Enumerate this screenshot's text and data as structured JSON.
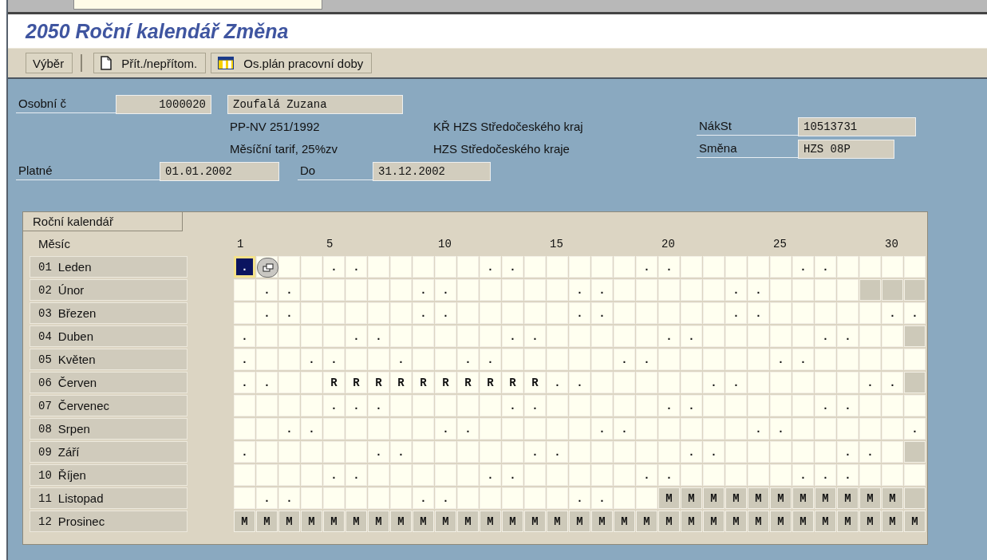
{
  "window": {
    "title": "2050 Roční kalendář Změna"
  },
  "toolbar": [
    {
      "label": "Výběr",
      "kind": "plain",
      "separator_after": true
    },
    {
      "label": "Přít./nepřítom.",
      "kind": "document",
      "separator_after": false
    },
    {
      "label": "Os.plán pracovní doby",
      "kind": "planner",
      "separator_after": false
    }
  ],
  "header": {
    "personnel_label": "Osobní č",
    "personnel_number": "1000020",
    "employee_name": "Zoufalá Zuzana",
    "line_2": {
      "left": "PP-NV 251/1992",
      "middle": "KŘ HZS Středočeského kraj",
      "label": "NákSt",
      "value": "10513731"
    },
    "line_3": {
      "left": "Měsíční tarif, 25%zv",
      "middle": "HZS Středočeského kraje",
      "label": "Směna",
      "value": "HZS 08P"
    },
    "valid_label": "Platné",
    "valid_from": "01.01.2002",
    "to_label": "Do",
    "valid_to": "31.12.2002"
  },
  "calendar": {
    "title": "Roční kalendář",
    "month_heading": "Měsíc",
    "day_header": [
      {
        "label": "1"
      },
      {
        "label": "5"
      },
      {
        "label": "10"
      },
      {
        "label": "15"
      },
      {
        "label": "20"
      },
      {
        "label": "25"
      },
      {
        "label": "30"
      }
    ],
    "months": [
      {
        "number": "01",
        "name": "Leden",
        "days": [
          {
            "text": ".",
            "shaded": false,
            "selected": true
          },
          {
            "shaded": false,
            "selected": false
          },
          {
            "shaded": false,
            "selected": false
          },
          {
            "shaded": false,
            "selected": false
          },
          {
            "text": ".",
            "shaded": false,
            "selected": false
          },
          {
            "text": ".",
            "shaded": false,
            "selected": false
          },
          {
            "shaded": false,
            "selected": false
          },
          {
            "shaded": false,
            "selected": false
          },
          {
            "shaded": false,
            "selected": false
          },
          {
            "shaded": false,
            "selected": false
          },
          {
            "shaded": false,
            "selected": false
          },
          {
            "text": ".",
            "shaded": false,
            "selected": false
          },
          {
            "text": ".",
            "shaded": false,
            "selected": false
          },
          {
            "shaded": false,
            "selected": false
          },
          {
            "shaded": false,
            "selected": false
          },
          {
            "shaded": false,
            "selected": false
          },
          {
            "shaded": false,
            "selected": false
          },
          {
            "shaded": false,
            "selected": false
          },
          {
            "text": ".",
            "shaded": false,
            "selected": false
          },
          {
            "text": ".",
            "shaded": false,
            "selected": false
          },
          {
            "shaded": false,
            "selected": false
          },
          {
            "shaded": false,
            "selected": false
          },
          {
            "shaded": false,
            "selected": false
          },
          {
            "shaded": false,
            "selected": false
          },
          {
            "shaded": false,
            "selected": false
          },
          {
            "text": ".",
            "shaded": false,
            "selected": false
          },
          {
            "text": ".",
            "shaded": false,
            "selected": false
          },
          {
            "shaded": false,
            "selected": false
          },
          {
            "shaded": false,
            "selected": false
          },
          {
            "shaded": false,
            "selected": false
          },
          {
            "shaded": false,
            "selected": false
          }
        ]
      },
      {
        "number": "02",
        "name": "Únor",
        "days": [
          {
            "shaded": false,
            "selected": false
          },
          {
            "text": ".",
            "shaded": false,
            "selected": false
          },
          {
            "text": ".",
            "shaded": false,
            "selected": false
          },
          {
            "shaded": false,
            "selected": false
          },
          {
            "shaded": false,
            "selected": false
          },
          {
            "shaded": false,
            "selected": false
          },
          {
            "shaded": false,
            "selected": false
          },
          {
            "shaded": false,
            "selected": false
          },
          {
            "text": ".",
            "shaded": false,
            "selected": false
          },
          {
            "text": ".",
            "shaded": false,
            "selected": false
          },
          {
            "shaded": false,
            "selected": false
          },
          {
            "shaded": false,
            "selected": false
          },
          {
            "shaded": false,
            "selected": false
          },
          {
            "shaded": false,
            "selected": false
          },
          {
            "shaded": false,
            "selected": false
          },
          {
            "text": ".",
            "shaded": false,
            "selected": false
          },
          {
            "text": ".",
            "shaded": false,
            "selected": false
          },
          {
            "shaded": false,
            "selected": false
          },
          {
            "shaded": false,
            "selected": false
          },
          {
            "shaded": false,
            "selected": false
          },
          {
            "shaded": false,
            "selected": false
          },
          {
            "shaded": false,
            "selected": false
          },
          {
            "text": ".",
            "shaded": false,
            "selected": false
          },
          {
            "text": ".",
            "shaded": false,
            "selected": false
          },
          {
            "shaded": false,
            "selected": false
          },
          {
            "shaded": false,
            "selected": false
          },
          {
            "shaded": false,
            "selected": false
          },
          {
            "shaded": false,
            "selected": false
          },
          {
            "shaded": true,
            "selected": false
          },
          {
            "shaded": true,
            "selected": false
          },
          {
            "shaded": true,
            "selected": false
          }
        ]
      },
      {
        "number": "03",
        "name": "Březen",
        "days": [
          {
            "shaded": false,
            "selected": false
          },
          {
            "text": ".",
            "shaded": false,
            "selected": false
          },
          {
            "text": ".",
            "shaded": false,
            "selected": false
          },
          {
            "shaded": false,
            "selected": false
          },
          {
            "shaded": false,
            "selected": false
          },
          {
            "shaded": false,
            "selected": false
          },
          {
            "shaded": false,
            "selected": false
          },
          {
            "shaded": false,
            "selected": false
          },
          {
            "text": ".",
            "shaded": false,
            "selected": false
          },
          {
            "text": ".",
            "shaded": false,
            "selected": false
          },
          {
            "shaded": false,
            "selected": false
          },
          {
            "shaded": false,
            "selected": false
          },
          {
            "shaded": false,
            "selected": false
          },
          {
            "shaded": false,
            "selected": false
          },
          {
            "shaded": false,
            "selected": false
          },
          {
            "text": ".",
            "shaded": false,
            "selected": false
          },
          {
            "text": ".",
            "shaded": false,
            "selected": false
          },
          {
            "shaded": false,
            "selected": false
          },
          {
            "shaded": false,
            "selected": false
          },
          {
            "shaded": false,
            "selected": false
          },
          {
            "shaded": false,
            "selected": false
          },
          {
            "shaded": false,
            "selected": false
          },
          {
            "text": ".",
            "shaded": false,
            "selected": false
          },
          {
            "text": ".",
            "shaded": false,
            "selected": false
          },
          {
            "shaded": false,
            "selected": false
          },
          {
            "shaded": false,
            "selected": false
          },
          {
            "shaded": false,
            "selected": false
          },
          {
            "shaded": false,
            "selected": false
          },
          {
            "shaded": false,
            "selected": false
          },
          {
            "text": ".",
            "shaded": false,
            "selected": false
          },
          {
            "text": ".",
            "shaded": false,
            "selected": false
          }
        ]
      },
      {
        "number": "04",
        "name": "Duben",
        "days": [
          {
            "text": ".",
            "shaded": false,
            "selected": false
          },
          {
            "shaded": false,
            "selected": false
          },
          {
            "shaded": false,
            "selected": false
          },
          {
            "shaded": false,
            "selected": false
          },
          {
            "shaded": false,
            "selected": false
          },
          {
            "text": ".",
            "shaded": false,
            "selected": false
          },
          {
            "text": ".",
            "shaded": false,
            "selected": false
          },
          {
            "shaded": false,
            "selected": false
          },
          {
            "shaded": false,
            "selected": false
          },
          {
            "shaded": false,
            "selected": false
          },
          {
            "shaded": false,
            "selected": false
          },
          {
            "shaded": false,
            "selected": false
          },
          {
            "text": ".",
            "shaded": false,
            "selected": false
          },
          {
            "text": ".",
            "shaded": false,
            "selected": false
          },
          {
            "shaded": false,
            "selected": false
          },
          {
            "shaded": false,
            "selected": false
          },
          {
            "shaded": false,
            "selected": false
          },
          {
            "shaded": false,
            "selected": false
          },
          {
            "shaded": false,
            "selected": false
          },
          {
            "text": ".",
            "shaded": false,
            "selected": false
          },
          {
            "text": ".",
            "shaded": false,
            "selected": false
          },
          {
            "shaded": false,
            "selected": false
          },
          {
            "shaded": false,
            "selected": false
          },
          {
            "shaded": false,
            "selected": false
          },
          {
            "shaded": false,
            "selected": false
          },
          {
            "shaded": false,
            "selected": false
          },
          {
            "text": ".",
            "shaded": false,
            "selected": false
          },
          {
            "text": ".",
            "shaded": false,
            "selected": false
          },
          {
            "shaded": false,
            "selected": false
          },
          {
            "shaded": false,
            "selected": false
          },
          {
            "shaded": true,
            "selected": false
          }
        ]
      },
      {
        "number": "05",
        "name": "Květen",
        "days": [
          {
            "text": ".",
            "shaded": false,
            "selected": false
          },
          {
            "shaded": false,
            "selected": false
          },
          {
            "shaded": false,
            "selected": false
          },
          {
            "text": ".",
            "shaded": false,
            "selected": false
          },
          {
            "text": ".",
            "shaded": false,
            "selected": false
          },
          {
            "shaded": false,
            "selected": false
          },
          {
            "shaded": false,
            "selected": false
          },
          {
            "text": ".",
            "shaded": false,
            "selected": false
          },
          {
            "shaded": false,
            "selected": false
          },
          {
            "shaded": false,
            "selected": false
          },
          {
            "text": ".",
            "shaded": false,
            "selected": false
          },
          {
            "text": ".",
            "shaded": false,
            "selected": false
          },
          {
            "shaded": false,
            "selected": false
          },
          {
            "shaded": false,
            "selected": false
          },
          {
            "shaded": false,
            "selected": false
          },
          {
            "shaded": false,
            "selected": false
          },
          {
            "shaded": false,
            "selected": false
          },
          {
            "text": ".",
            "shaded": false,
            "selected": false
          },
          {
            "text": ".",
            "shaded": false,
            "selected": false
          },
          {
            "shaded": false,
            "selected": false
          },
          {
            "shaded": false,
            "selected": false
          },
          {
            "shaded": false,
            "selected": false
          },
          {
            "shaded": false,
            "selected": false
          },
          {
            "shaded": false,
            "selected": false
          },
          {
            "text": ".",
            "shaded": false,
            "selected": false
          },
          {
            "text": ".",
            "shaded": false,
            "selected": false
          },
          {
            "shaded": false,
            "selected": false
          },
          {
            "shaded": false,
            "selected": false
          },
          {
            "shaded": false,
            "selected": false
          },
          {
            "shaded": false,
            "selected": false
          },
          {
            "shaded": false,
            "selected": false
          }
        ]
      },
      {
        "number": "06",
        "name": "Červen",
        "days": [
          {
            "text": ".",
            "shaded": false,
            "selected": false
          },
          {
            "text": ".",
            "shaded": false,
            "selected": false
          },
          {
            "shaded": false,
            "selected": false
          },
          {
            "shaded": false,
            "selected": false
          },
          {
            "text": "R",
            "shaded": false,
            "selected": false
          },
          {
            "text": "R",
            "shaded": false,
            "selected": false
          },
          {
            "text": "R",
            "shaded": false,
            "selected": false
          },
          {
            "text": "R",
            "shaded": false,
            "selected": false
          },
          {
            "text": "R",
            "shaded": false,
            "selected": false
          },
          {
            "text": "R",
            "shaded": false,
            "selected": false
          },
          {
            "text": "R",
            "shaded": false,
            "selected": false
          },
          {
            "text": "R",
            "shaded": false,
            "selected": false
          },
          {
            "text": "R",
            "shaded": false,
            "selected": false
          },
          {
            "text": "R",
            "shaded": false,
            "selected": false
          },
          {
            "text": ".",
            "shaded": false,
            "selected": false
          },
          {
            "text": ".",
            "shaded": false,
            "selected": false
          },
          {
            "shaded": false,
            "selected": false
          },
          {
            "shaded": false,
            "selected": false
          },
          {
            "shaded": false,
            "selected": false
          },
          {
            "shaded": false,
            "selected": false
          },
          {
            "shaded": false,
            "selected": false
          },
          {
            "text": ".",
            "shaded": false,
            "selected": false
          },
          {
            "text": ".",
            "shaded": false,
            "selected": false
          },
          {
            "shaded": false,
            "selected": false
          },
          {
            "shaded": false,
            "selected": false
          },
          {
            "shaded": false,
            "selected": false
          },
          {
            "shaded": false,
            "selected": false
          },
          {
            "shaded": false,
            "selected": false
          },
          {
            "text": ".",
            "shaded": false,
            "selected": false
          },
          {
            "text": ".",
            "shaded": false,
            "selected": false
          },
          {
            "shaded": true,
            "selected": false
          }
        ]
      },
      {
        "number": "07",
        "name": "Červenec",
        "days": [
          {
            "shaded": false,
            "selected": false
          },
          {
            "shaded": false,
            "selected": false
          },
          {
            "shaded": false,
            "selected": false
          },
          {
            "shaded": false,
            "selected": false
          },
          {
            "text": ".",
            "shaded": false,
            "selected": false
          },
          {
            "text": ".",
            "shaded": false,
            "selected": false
          },
          {
            "text": ".",
            "shaded": false,
            "selected": false
          },
          {
            "shaded": false,
            "selected": false
          },
          {
            "shaded": false,
            "selected": false
          },
          {
            "shaded": false,
            "selected": false
          },
          {
            "shaded": false,
            "selected": false
          },
          {
            "shaded": false,
            "selected": false
          },
          {
            "text": ".",
            "shaded": false,
            "selected": false
          },
          {
            "text": ".",
            "shaded": false,
            "selected": false
          },
          {
            "shaded": false,
            "selected": false
          },
          {
            "shaded": false,
            "selected": false
          },
          {
            "shaded": false,
            "selected": false
          },
          {
            "shaded": false,
            "selected": false
          },
          {
            "shaded": false,
            "selected": false
          },
          {
            "text": ".",
            "shaded": false,
            "selected": false
          },
          {
            "text": ".",
            "shaded": false,
            "selected": false
          },
          {
            "shaded": false,
            "selected": false
          },
          {
            "shaded": false,
            "selected": false
          },
          {
            "shaded": false,
            "selected": false
          },
          {
            "shaded": false,
            "selected": false
          },
          {
            "shaded": false,
            "selected": false
          },
          {
            "text": ".",
            "shaded": false,
            "selected": false
          },
          {
            "text": ".",
            "shaded": false,
            "selected": false
          },
          {
            "shaded": false,
            "selected": false
          },
          {
            "shaded": false,
            "selected": false
          },
          {
            "shaded": false,
            "selected": false
          }
        ]
      },
      {
        "number": "08",
        "name": "Srpen",
        "days": [
          {
            "shaded": false,
            "selected": false
          },
          {
            "shaded": false,
            "selected": false
          },
          {
            "text": ".",
            "shaded": false,
            "selected": false
          },
          {
            "text": ".",
            "shaded": false,
            "selected": false
          },
          {
            "shaded": false,
            "selected": false
          },
          {
            "shaded": false,
            "selected": false
          },
          {
            "shaded": false,
            "selected": false
          },
          {
            "shaded": false,
            "selected": false
          },
          {
            "shaded": false,
            "selected": false
          },
          {
            "text": ".",
            "shaded": false,
            "selected": false
          },
          {
            "text": ".",
            "shaded": false,
            "selected": false
          },
          {
            "shaded": false,
            "selected": false
          },
          {
            "shaded": false,
            "selected": false
          },
          {
            "shaded": false,
            "selected": false
          },
          {
            "shaded": false,
            "selected": false
          },
          {
            "shaded": false,
            "selected": false
          },
          {
            "text": ".",
            "shaded": false,
            "selected": false
          },
          {
            "text": ".",
            "shaded": false,
            "selected": false
          },
          {
            "shaded": false,
            "selected": false
          },
          {
            "shaded": false,
            "selected": false
          },
          {
            "shaded": false,
            "selected": false
          },
          {
            "shaded": false,
            "selected": false
          },
          {
            "shaded": false,
            "selected": false
          },
          {
            "text": ".",
            "shaded": false,
            "selected": false
          },
          {
            "text": ".",
            "shaded": false,
            "selected": false
          },
          {
            "shaded": false,
            "selected": false
          },
          {
            "shaded": false,
            "selected": false
          },
          {
            "shaded": false,
            "selected": false
          },
          {
            "shaded": false,
            "selected": false
          },
          {
            "shaded": false,
            "selected": false
          },
          {
            "text": ".",
            "shaded": false,
            "selected": false
          }
        ]
      },
      {
        "number": "09",
        "name": "Září",
        "days": [
          {
            "text": ".",
            "shaded": false,
            "selected": false
          },
          {
            "shaded": false,
            "selected": false
          },
          {
            "shaded": false,
            "selected": false
          },
          {
            "shaded": false,
            "selected": false
          },
          {
            "shaded": false,
            "selected": false
          },
          {
            "shaded": false,
            "selected": false
          },
          {
            "text": ".",
            "shaded": false,
            "selected": false
          },
          {
            "text": ".",
            "shaded": false,
            "selected": false
          },
          {
            "shaded": false,
            "selected": false
          },
          {
            "shaded": false,
            "selected": false
          },
          {
            "shaded": false,
            "selected": false
          },
          {
            "shaded": false,
            "selected": false
          },
          {
            "shaded": false,
            "selected": false
          },
          {
            "text": ".",
            "shaded": false,
            "selected": false
          },
          {
            "text": ".",
            "shaded": false,
            "selected": false
          },
          {
            "shaded": false,
            "selected": false
          },
          {
            "shaded": false,
            "selected": false
          },
          {
            "shaded": false,
            "selected": false
          },
          {
            "shaded": false,
            "selected": false
          },
          {
            "shaded": false,
            "selected": false
          },
          {
            "text": ".",
            "shaded": false,
            "selected": false
          },
          {
            "text": ".",
            "shaded": false,
            "selected": false
          },
          {
            "shaded": false,
            "selected": false
          },
          {
            "shaded": false,
            "selected": false
          },
          {
            "shaded": false,
            "selected": false
          },
          {
            "shaded": false,
            "selected": false
          },
          {
            "shaded": false,
            "selected": false
          },
          {
            "text": ".",
            "shaded": false,
            "selected": false
          },
          {
            "text": ".",
            "shaded": false,
            "selected": false
          },
          {
            "shaded": false,
            "selected": false
          },
          {
            "shaded": true,
            "selected": false
          }
        ]
      },
      {
        "number": "10",
        "name": "Říjen",
        "days": [
          {
            "shaded": false,
            "selected": false
          },
          {
            "shaded": false,
            "selected": false
          },
          {
            "shaded": false,
            "selected": false
          },
          {
            "shaded": false,
            "selected": false
          },
          {
            "text": ".",
            "shaded": false,
            "selected": false
          },
          {
            "text": ".",
            "shaded": false,
            "selected": false
          },
          {
            "shaded": false,
            "selected": false
          },
          {
            "shaded": false,
            "selected": false
          },
          {
            "shaded": false,
            "selected": false
          },
          {
            "shaded": false,
            "selected": false
          },
          {
            "shaded": false,
            "selected": false
          },
          {
            "text": ".",
            "shaded": false,
            "selected": false
          },
          {
            "text": ".",
            "shaded": false,
            "selected": false
          },
          {
            "shaded": false,
            "selected": false
          },
          {
            "shaded": false,
            "selected": false
          },
          {
            "shaded": false,
            "selected": false
          },
          {
            "shaded": false,
            "selected": false
          },
          {
            "shaded": false,
            "selected": false
          },
          {
            "text": ".",
            "shaded": false,
            "selected": false
          },
          {
            "text": ".",
            "shaded": false,
            "selected": false
          },
          {
            "shaded": false,
            "selected": false
          },
          {
            "shaded": false,
            "selected": false
          },
          {
            "shaded": false,
            "selected": false
          },
          {
            "shaded": false,
            "selected": false
          },
          {
            "shaded": false,
            "selected": false
          },
          {
            "text": ".",
            "shaded": false,
            "selected": false
          },
          {
            "text": ".",
            "shaded": false,
            "selected": false
          },
          {
            "text": ".",
            "shaded": false,
            "selected": false
          },
          {
            "shaded": false,
            "selected": false
          },
          {
            "shaded": false,
            "selected": false
          },
          {
            "shaded": false,
            "selected": false
          }
        ]
      },
      {
        "number": "11",
        "name": "Listopad",
        "days": [
          {
            "shaded": false,
            "selected": false
          },
          {
            "text": ".",
            "shaded": false,
            "selected": false
          },
          {
            "text": ".",
            "shaded": false,
            "selected": false
          },
          {
            "shaded": false,
            "selected": false
          },
          {
            "shaded": false,
            "selected": false
          },
          {
            "shaded": false,
            "selected": false
          },
          {
            "shaded": false,
            "selected": false
          },
          {
            "shaded": false,
            "selected": false
          },
          {
            "text": ".",
            "shaded": false,
            "selected": false
          },
          {
            "text": ".",
            "shaded": false,
            "selected": false
          },
          {
            "shaded": false,
            "selected": false
          },
          {
            "shaded": false,
            "selected": false
          },
          {
            "shaded": false,
            "selected": false
          },
          {
            "shaded": false,
            "selected": false
          },
          {
            "shaded": false,
            "selected": false
          },
          {
            "text": ".",
            "shaded": false,
            "selected": false
          },
          {
            "text": ".",
            "shaded": false,
            "selected": false
          },
          {
            "shaded": false,
            "selected": false
          },
          {
            "shaded": false,
            "selected": false
          },
          {
            "text": "M",
            "shaded": true,
            "selected": false
          },
          {
            "text": "M",
            "shaded": true,
            "selected": false
          },
          {
            "text": "M",
            "shaded": true,
            "selected": false
          },
          {
            "text": "M",
            "shaded": true,
            "selected": false
          },
          {
            "text": "M",
            "shaded": true,
            "selected": false
          },
          {
            "text": "M",
            "shaded": true,
            "selected": false
          },
          {
            "text": "M",
            "shaded": true,
            "selected": false
          },
          {
            "text": "M",
            "shaded": true,
            "selected": false
          },
          {
            "text": "M",
            "shaded": true,
            "selected": false
          },
          {
            "text": "M",
            "shaded": true,
            "selected": false
          },
          {
            "text": "M",
            "shaded": true,
            "selected": false
          },
          {
            "shaded": true,
            "selected": false
          }
        ]
      },
      {
        "number": "12",
        "name": "Prosinec",
        "days": [
          {
            "text": "M",
            "shaded": true,
            "selected": false
          },
          {
            "text": "M",
            "shaded": true,
            "selected": false
          },
          {
            "text": "M",
            "shaded": true,
            "selected": false
          },
          {
            "text": "M",
            "shaded": true,
            "selected": false
          },
          {
            "text": "M",
            "shaded": true,
            "selected": false
          },
          {
            "text": "M",
            "shaded": true,
            "selected": false
          },
          {
            "text": "M",
            "shaded": true,
            "selected": false
          },
          {
            "text": "M",
            "shaded": true,
            "selected": false
          },
          {
            "text": "M",
            "shaded": true,
            "selected": false
          },
          {
            "text": "M",
            "shaded": true,
            "selected": false
          },
          {
            "text": "M",
            "shaded": true,
            "selected": false
          },
          {
            "text": "M",
            "shaded": true,
            "selected": false
          },
          {
            "text": "M",
            "shaded": true,
            "selected": false
          },
          {
            "text": "M",
            "shaded": true,
            "selected": false
          },
          {
            "text": "M",
            "shaded": true,
            "selected": false
          },
          {
            "text": "M",
            "shaded": true,
            "selected": false
          },
          {
            "text": "M",
            "shaded": true,
            "selected": false
          },
          {
            "text": "M",
            "shaded": true,
            "selected": false
          },
          {
            "text": "M",
            "shaded": true,
            "selected": false
          },
          {
            "text": "M",
            "shaded": true,
            "selected": false
          },
          {
            "text": "M",
            "shaded": true,
            "selected": false
          },
          {
            "text": "M",
            "shaded": true,
            "selected": false
          },
          {
            "text": "M",
            "shaded": true,
            "selected": false
          },
          {
            "text": "M",
            "shaded": true,
            "selected": false
          },
          {
            "text": "M",
            "shaded": true,
            "selected": false
          },
          {
            "text": "M",
            "shaded": true,
            "selected": false
          },
          {
            "text": "M",
            "shaded": true,
            "selected": false
          },
          {
            "text": "M",
            "shaded": true,
            "selected": false
          },
          {
            "text": "M",
            "shaded": true,
            "selected": false
          },
          {
            "text": "M",
            "shaded": true,
            "selected": false
          },
          {
            "text": "M",
            "shaded": true,
            "selected": false
          }
        ]
      }
    ]
  }
}
